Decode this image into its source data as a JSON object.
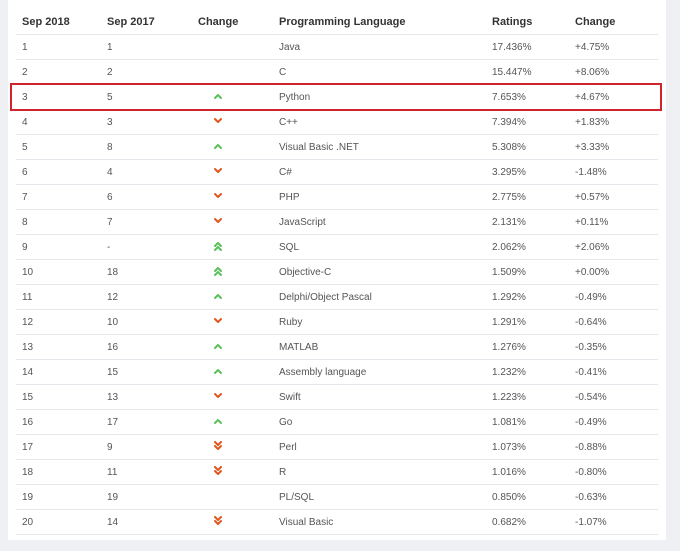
{
  "colors": {
    "up": "#5bbf5b",
    "down": "#e0561e",
    "highlight": "#d0242c"
  },
  "headers": [
    "Sep 2018",
    "Sep 2017",
    "Change",
    "Programming Language",
    "Ratings",
    "Change"
  ],
  "rows": [
    {
      "r2018": "1",
      "r2017": "1",
      "trend": "none",
      "language": "Java",
      "rating": "17.436%",
      "change": "+4.75%"
    },
    {
      "r2018": "2",
      "r2017": "2",
      "trend": "none",
      "language": "C",
      "rating": "15.447%",
      "change": "+8.06%"
    },
    {
      "r2018": "3",
      "r2017": "5",
      "trend": "up",
      "language": "Python",
      "rating": "7.653%",
      "change": "+4.67%",
      "highlighted": true
    },
    {
      "r2018": "4",
      "r2017": "3",
      "trend": "down",
      "language": "C++",
      "rating": "7.394%",
      "change": "+1.83%"
    },
    {
      "r2018": "5",
      "r2017": "8",
      "trend": "up",
      "language": "Visual Basic .NET",
      "rating": "5.308%",
      "change": "+3.33%"
    },
    {
      "r2018": "6",
      "r2017": "4",
      "trend": "down",
      "language": "C#",
      "rating": "3.295%",
      "change": "-1.48%"
    },
    {
      "r2018": "7",
      "r2017": "6",
      "trend": "down",
      "language": "PHP",
      "rating": "2.775%",
      "change": "+0.57%"
    },
    {
      "r2018": "8",
      "r2017": "7",
      "trend": "down",
      "language": "JavaScript",
      "rating": "2.131%",
      "change": "+0.11%"
    },
    {
      "r2018": "9",
      "r2017": "-",
      "trend": "double-up",
      "language": "SQL",
      "rating": "2.062%",
      "change": "+2.06%"
    },
    {
      "r2018": "10",
      "r2017": "18",
      "trend": "double-up",
      "language": "Objective-C",
      "rating": "1.509%",
      "change": "+0.00%"
    },
    {
      "r2018": "11",
      "r2017": "12",
      "trend": "up",
      "language": "Delphi/Object Pascal",
      "rating": "1.292%",
      "change": "-0.49%"
    },
    {
      "r2018": "12",
      "r2017": "10",
      "trend": "down",
      "language": "Ruby",
      "rating": "1.291%",
      "change": "-0.64%"
    },
    {
      "r2018": "13",
      "r2017": "16",
      "trend": "up",
      "language": "MATLAB",
      "rating": "1.276%",
      "change": "-0.35%"
    },
    {
      "r2018": "14",
      "r2017": "15",
      "trend": "up",
      "language": "Assembly language",
      "rating": "1.232%",
      "change": "-0.41%"
    },
    {
      "r2018": "15",
      "r2017": "13",
      "trend": "down",
      "language": "Swift",
      "rating": "1.223%",
      "change": "-0.54%"
    },
    {
      "r2018": "16",
      "r2017": "17",
      "trend": "up",
      "language": "Go",
      "rating": "1.081%",
      "change": "-0.49%"
    },
    {
      "r2018": "17",
      "r2017": "9",
      "trend": "double-down",
      "language": "Perl",
      "rating": "1.073%",
      "change": "-0.88%"
    },
    {
      "r2018": "18",
      "r2017": "11",
      "trend": "double-down",
      "language": "R",
      "rating": "1.016%",
      "change": "-0.80%"
    },
    {
      "r2018": "19",
      "r2017": "19",
      "trend": "none",
      "language": "PL/SQL",
      "rating": "0.850%",
      "change": "-0.63%"
    },
    {
      "r2018": "20",
      "r2017": "14",
      "trend": "double-down",
      "language": "Visual Basic",
      "rating": "0.682%",
      "change": "-1.07%"
    }
  ]
}
